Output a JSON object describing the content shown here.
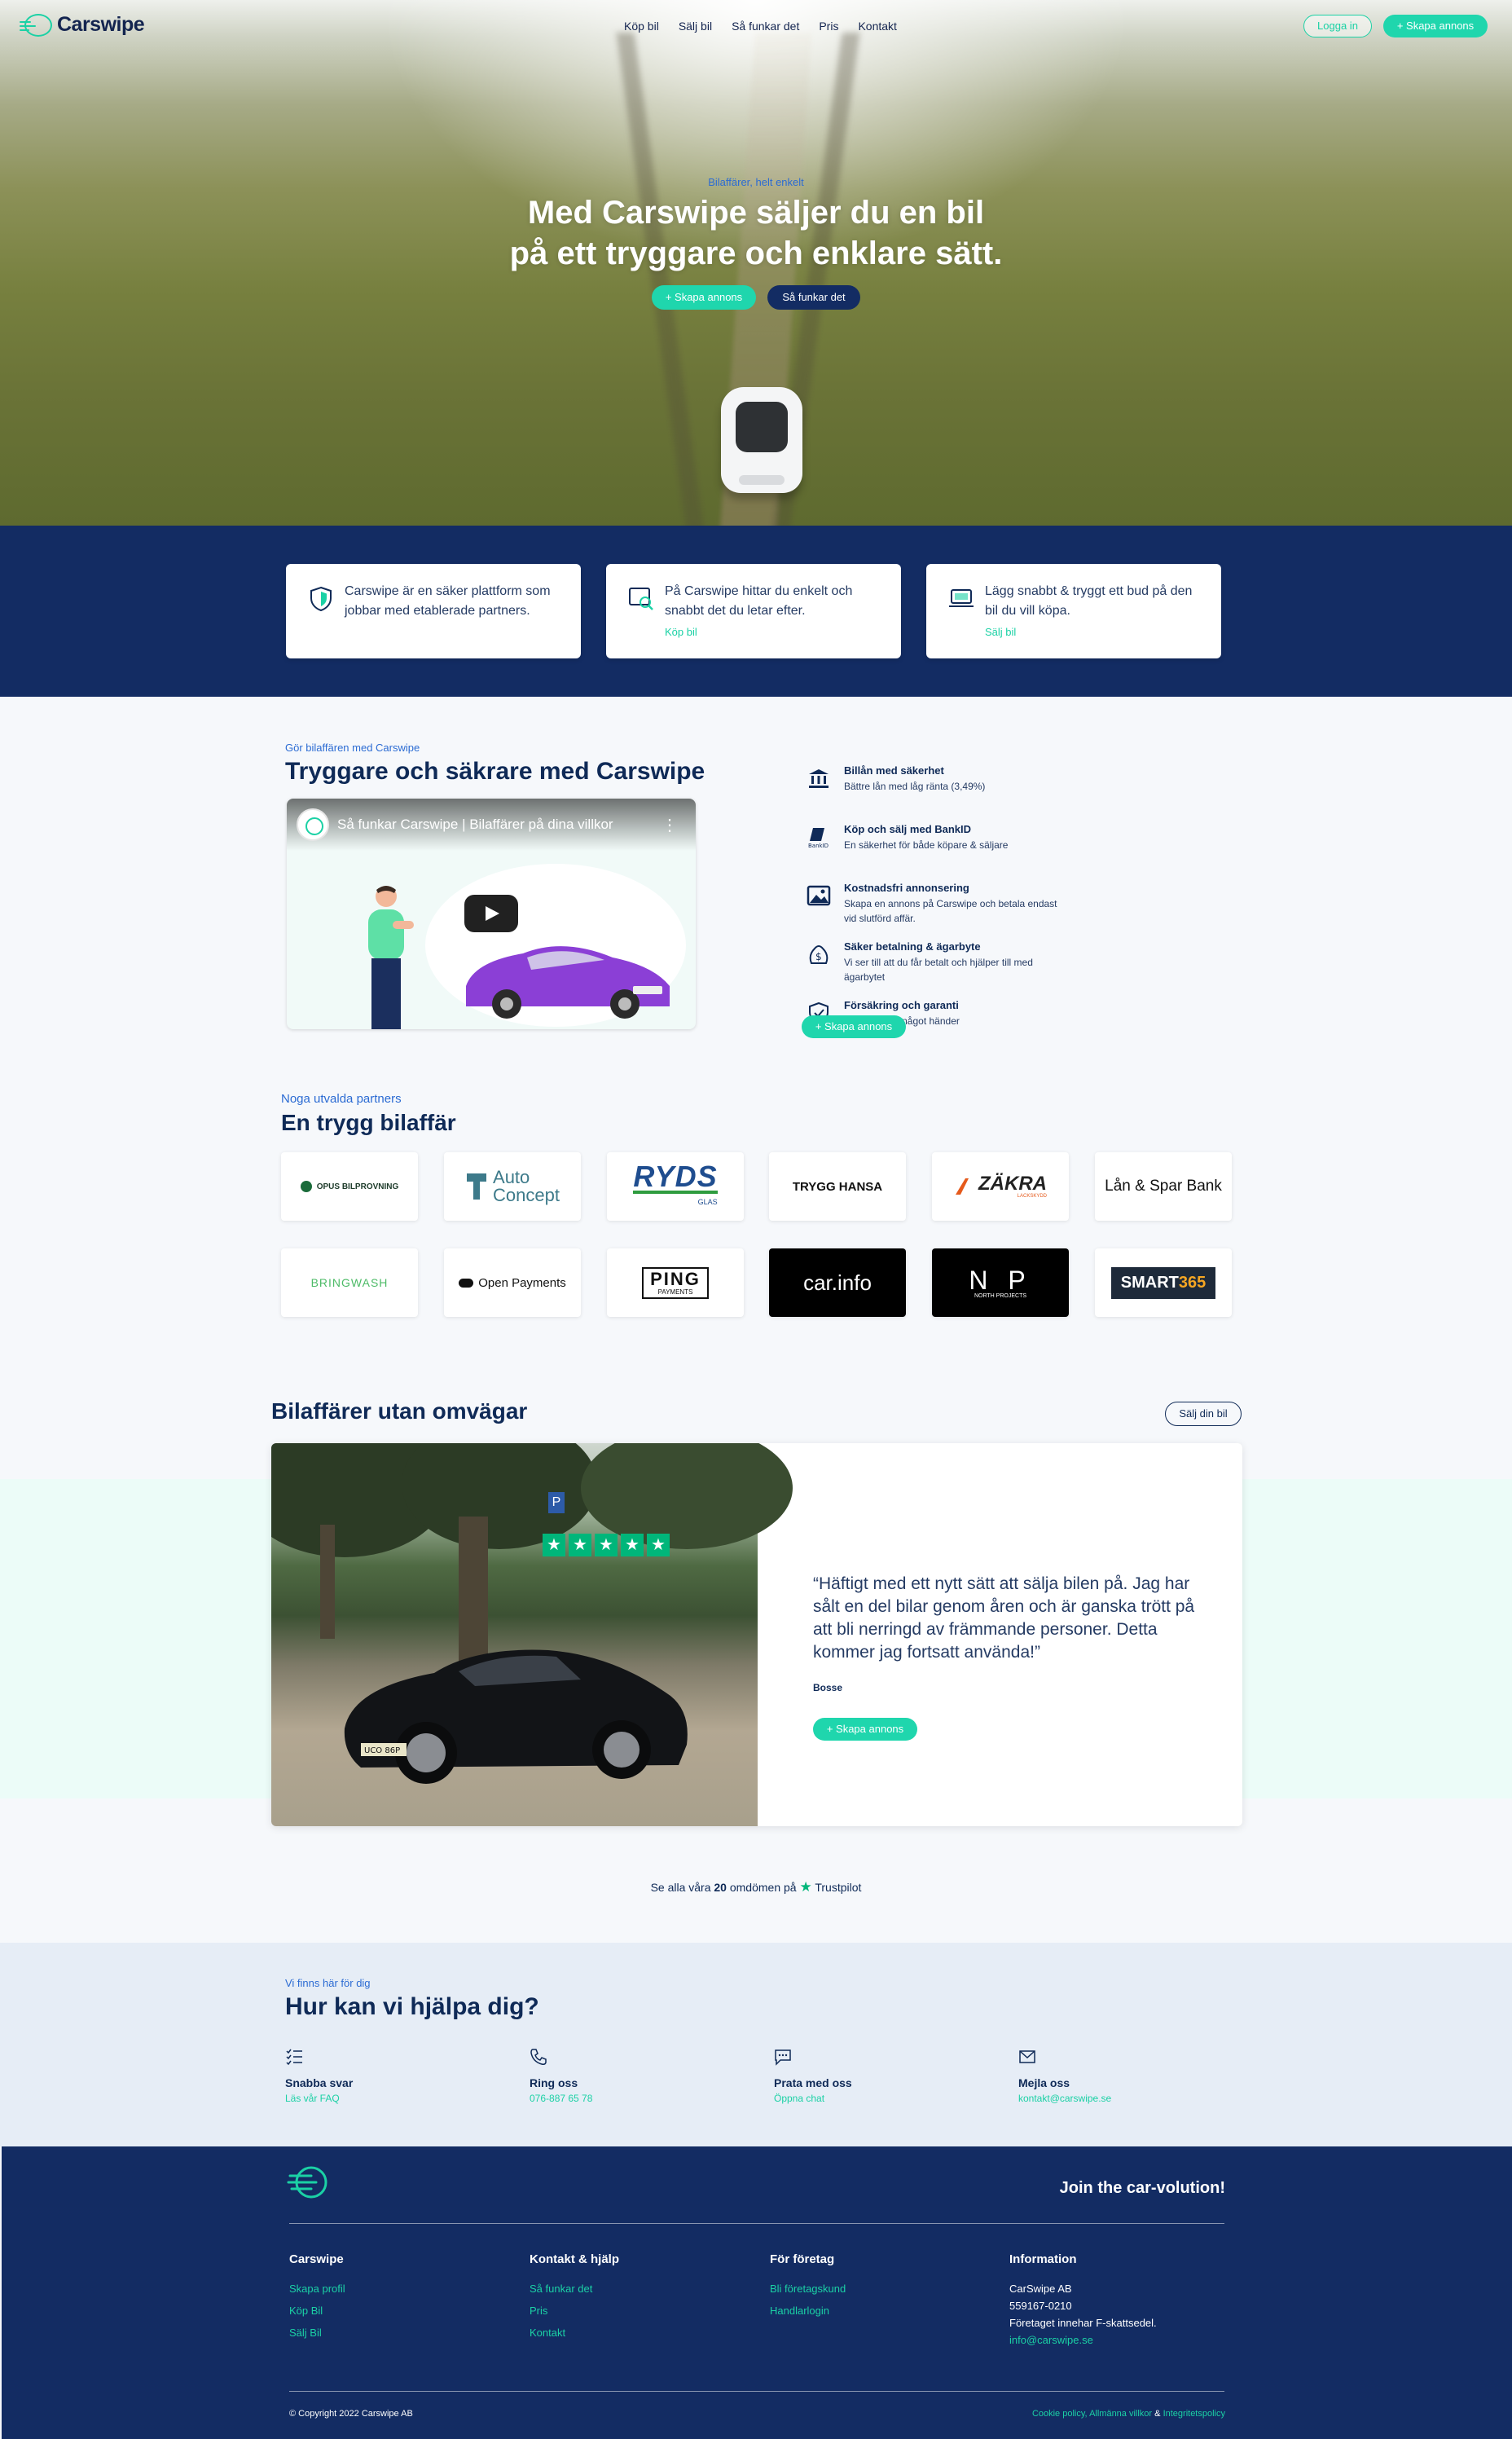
{
  "brand": {
    "name": "Carswipe",
    "accent": "#1fd6ad",
    "navy": "#132c63"
  },
  "nav": {
    "links": [
      "Köp bil",
      "Sälj bil",
      "Så funkar det",
      "Pris",
      "Kontakt"
    ],
    "login": "Logga in",
    "create": "+ Skapa annons"
  },
  "hero": {
    "kicker": "Bilaffärer, helt enkelt",
    "title_line1": "Med Carswipe säljer du en bil",
    "title_line2": "på ett tryggare och enklare sätt.",
    "cta_primary": "+ Skapa annons",
    "cta_secondary": "Så funkar det"
  },
  "features": [
    {
      "text": "Carswipe är en säker plattform som jobbar med etablerade partners.",
      "link": "",
      "icon": "shield-icon"
    },
    {
      "text": "På Carswipe hittar du enkelt och snabbt det du letar efter.",
      "link": "Köp bil",
      "icon": "search-icon"
    },
    {
      "text": "Lägg snabbt & tryggt ett bud på den bil du vill köpa.",
      "link": "Sälj bil",
      "icon": "laptop-icon"
    }
  ],
  "about": {
    "kicker": "Gör bilaffären med Carswipe",
    "title": "Tryggare och säkrare med Carswipe",
    "video_title": "Så funkar Carswipe | Bilaffärer på dina villkor",
    "items": [
      {
        "title": "Billån med säkerhet",
        "text": "Bättre lån med låg ränta (3,49%)",
        "icon": "bank-icon"
      },
      {
        "title": "Köp och sälj med BankID",
        "text": "En säkerhet för både köpare & säljare",
        "icon": "bankid-icon"
      },
      {
        "title": "Kostnadsfri annonsering",
        "text": "Skapa en annons på Carswipe och betala endast vid slutförd affär.",
        "icon": "image-icon"
      },
      {
        "title": "Säker betalning & ägarbyte",
        "text": "Vi ser till att du får betalt och hjälper till med ägarbytet",
        "icon": "money-bag-icon"
      },
      {
        "title": "Försäkring och garanti",
        "text": "Var trygg om något händer",
        "icon": "shield-check-icon"
      }
    ],
    "cta": "+ Skapa annons"
  },
  "partners": {
    "kicker": "Noga utvalda partners",
    "title": "En trygg bilaffär",
    "logos": [
      {
        "name": "OPUS BILPROVNING"
      },
      {
        "name": "Auto",
        "name2": "Concept"
      },
      {
        "name": "RYDS",
        "name2": "GLAS"
      },
      {
        "name": "TRYGG HANSA"
      },
      {
        "name": "ZÄKRA",
        "name2": "LACKSKYDD"
      },
      {
        "name": "Lån & Spar Bank"
      },
      {
        "name": "BRINGWASH"
      },
      {
        "name": "Open Payments"
      },
      {
        "name": "PING",
        "name2": "PAYMENTS"
      },
      {
        "name": "car.info"
      },
      {
        "name": "N P",
        "name2": "NORTH PROJECTS"
      },
      {
        "name": "SMART",
        "name2": "365"
      }
    ]
  },
  "testimonial": {
    "section_title": "Bilaffärer utan omvägar",
    "sell_button": "Sälj din bil",
    "stars": 5,
    "quote": "“Häftigt med ett nytt sätt att sälja bilen på. Jag har sålt en del bilar genom åren och är ganska trött på att bli nerringd av främmande personer. Detta kommer jag fortsatt använda!”",
    "author": "Bosse",
    "cta": "+ Skapa annons",
    "plate": "UCO 86P",
    "trustpilot_prefix": "Se alla våra",
    "trustpilot_count": "20",
    "trustpilot_suffix": "omdömen på",
    "trustpilot_brand": "Trustpilot"
  },
  "help": {
    "kicker": "Vi finns här för dig",
    "title": "Hur kan vi hjälpa dig?",
    "items": [
      {
        "title": "Snabba svar",
        "link": "Läs vår FAQ",
        "icon": "checklist-icon"
      },
      {
        "title": "Ring oss",
        "link": "076-887 65 78",
        "icon": "phone-icon"
      },
      {
        "title": "Prata med oss",
        "link": "Öppna chat",
        "icon": "chat-icon"
      },
      {
        "title": "Mejla oss",
        "link": "kontakt@carswipe.se",
        "icon": "mail-icon"
      }
    ]
  },
  "footer": {
    "tagline": "Join the car-volution!",
    "cols": [
      {
        "title": "Carswipe",
        "links": [
          "Skapa profil",
          "Köp Bil",
          "Sälj Bil"
        ]
      },
      {
        "title": "Kontakt & hjälp",
        "links": [
          "Så funkar det",
          "Pris",
          "Kontakt"
        ]
      },
      {
        "title": "För företag",
        "links": [
          "Bli företagskund",
          "Handlarlogin"
        ]
      }
    ],
    "info": {
      "title": "Information",
      "lines": [
        "CarSwipe AB",
        "559167-0210",
        "Företaget innehar F-skattsedel."
      ],
      "email": "info@carswipe.se"
    },
    "copyright": "© Copyright 2022 Carswipe AB",
    "legal": {
      "cookie": "Cookie policy,",
      "terms": "Allmänna villkor",
      "amp": "&",
      "privacy": "Integritetspolicy"
    }
  }
}
